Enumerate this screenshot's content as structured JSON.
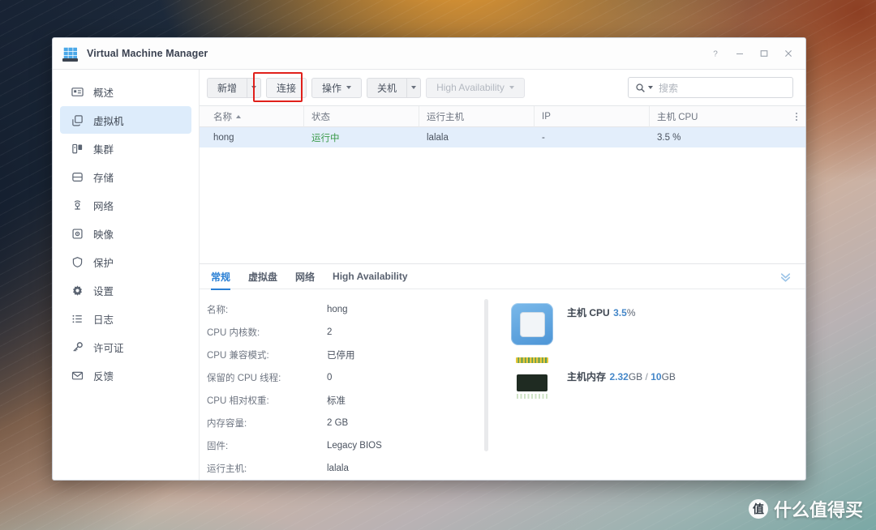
{
  "window": {
    "title": "Virtual Machine Manager",
    "app_icon": "server-rack-icon",
    "controls": [
      {
        "name": "help-button",
        "glyph": "?"
      },
      {
        "name": "minimize-button",
        "glyph": "—"
      },
      {
        "name": "maximize-button",
        "glyph": "□"
      },
      {
        "name": "close-button",
        "glyph": "✕"
      }
    ]
  },
  "sidebar": {
    "items": [
      {
        "label": "概述",
        "icon": "overview-icon",
        "active": false
      },
      {
        "label": "虚拟机",
        "icon": "virtual-machine-icon",
        "active": true
      },
      {
        "label": "集群",
        "icon": "cluster-icon",
        "active": false
      },
      {
        "label": "存储",
        "icon": "storage-icon",
        "active": false
      },
      {
        "label": "网络",
        "icon": "network-icon",
        "active": false
      },
      {
        "label": "映像",
        "icon": "image-icon",
        "active": false
      },
      {
        "label": "保护",
        "icon": "shield-icon",
        "active": false
      },
      {
        "label": "设置",
        "icon": "gear-icon",
        "active": false
      },
      {
        "label": "日志",
        "icon": "log-list-icon",
        "active": false
      },
      {
        "label": "许可证",
        "icon": "key-icon",
        "active": false
      },
      {
        "label": "反馈",
        "icon": "envelope-icon",
        "active": false
      }
    ]
  },
  "toolbar": {
    "create_label": "新增",
    "connect_label": "连接",
    "action_label": "操作",
    "shutdown_label": "关机",
    "high_availability_label": "High Availability",
    "highlight_color": "#e0201b"
  },
  "search": {
    "placeholder": "搜索",
    "value": "",
    "icon": "search-icon"
  },
  "table": {
    "columns": [
      {
        "label": "名称",
        "sorted": "asc",
        "width": 120
      },
      {
        "label": "状态",
        "width": 142
      },
      {
        "label": "运行主机",
        "width": 142
      },
      {
        "label": "IP",
        "width": 142
      },
      {
        "label": "主机 CPU",
        "width": 120
      }
    ],
    "rows": [
      {
        "name": "hong",
        "status": "运行中",
        "host": "lalala",
        "ip": "-",
        "cpu": "3.5 %",
        "selected": true
      }
    ],
    "status_color": "#3a9a4a"
  },
  "detail": {
    "tabs": [
      {
        "label": "常规",
        "active": true
      },
      {
        "label": "虚拟盘",
        "active": false
      },
      {
        "label": "网络",
        "active": false
      },
      {
        "label": "High Availability",
        "active": false
      }
    ],
    "collapse_icon": "chevron-double-down-icon",
    "properties": [
      {
        "key": "名称:",
        "value": "hong"
      },
      {
        "key": "CPU 内核数:",
        "value": "2"
      },
      {
        "key": "CPU 兼容模式:",
        "value": "已停用"
      },
      {
        "key": "保留的 CPU 线程:",
        "value": "0"
      },
      {
        "key": "CPU 相对权重:",
        "value": "标准"
      },
      {
        "key": "内存容量:",
        "value": "2 GB"
      },
      {
        "key": "固件:",
        "value": "Legacy BIOS"
      },
      {
        "key": "运行主机:",
        "value": "lalala"
      }
    ],
    "resources": [
      {
        "title": "主机 CPU",
        "icon": "cpu-chip-icon",
        "value": "3.5",
        "unit": "%",
        "percent": 3.5,
        "bar_color": "#3f8fd4"
      },
      {
        "title": "主机内存",
        "icon": "memory-module-icon",
        "value": "2.32",
        "unit": "GB",
        "separator": "/",
        "total": "10",
        "total_unit": "GB",
        "percent": 23.2,
        "bar_color": "#2f9b2f"
      }
    ]
  },
  "watermark": {
    "badge": "值",
    "text": "什么值得买"
  }
}
